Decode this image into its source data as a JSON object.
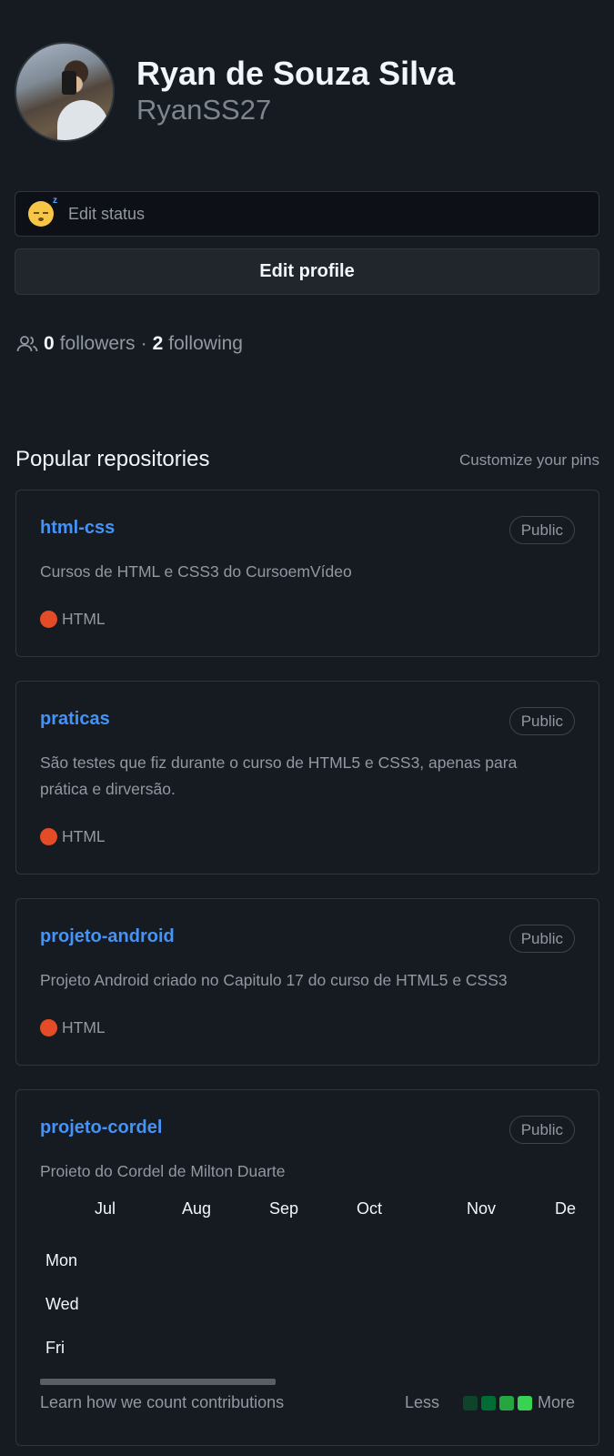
{
  "profile": {
    "full_name": "Ryan de Souza Silva",
    "login": "RyanSS27"
  },
  "status": {
    "label": "Edit status",
    "emoji_icon": "sleeping-face-icon"
  },
  "edit_profile": {
    "label": "Edit profile"
  },
  "follow": {
    "followers_count": "0",
    "followers_label": "followers",
    "separator": "·",
    "following_count": "2",
    "following_label": "following"
  },
  "repositories": {
    "title": "Popular repositories",
    "customize_label": "Customize your pins",
    "items": [
      {
        "name": "html-css",
        "visibility": "Public",
        "description": "Cursos de HTML e CSS3 do CursoemVídeo",
        "language": "HTML",
        "language_color": "#e34c26"
      },
      {
        "name": "praticas",
        "visibility": "Public",
        "description": "São testes que fiz durante o curso de HTML5 e CSS3, apenas para prática e dirversão.",
        "language": "HTML",
        "language_color": "#e34c26"
      },
      {
        "name": "projeto-android",
        "visibility": "Public",
        "description": "Projeto Android criado no Capitulo 17 do curso de HTML5 e CSS3",
        "language": "HTML",
        "language_color": "#e34c26"
      },
      {
        "name": "projeto-cordel",
        "visibility": "Public",
        "description": "Projeto do Cordel de Milton Duarte"
      }
    ]
  },
  "contributions": {
    "months": [
      "Jul",
      "Aug",
      "Sep",
      "Oct",
      "Nov",
      "De"
    ],
    "days": [
      "Mon",
      "Wed",
      "Fri"
    ],
    "learn_label": "Learn how we count contributions",
    "legend_less": "Less",
    "legend_more": "More",
    "legend_colors": [
      "#0e4429",
      "#006d32",
      "#26a641",
      "#39d353"
    ]
  }
}
